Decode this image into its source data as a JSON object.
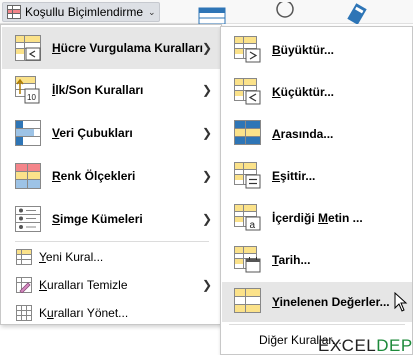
{
  "ribbon": {
    "conditional_formatting_label": "Koşullu Biçimlendirme"
  },
  "menu": {
    "items": [
      {
        "pre": "",
        "u": "H",
        "post": "ücre Vurgulama Kuralları",
        "icon": "highlight-cells-icon"
      },
      {
        "pre": "",
        "u": "İ",
        "post": "lk/Son Kuralları",
        "icon": "top-bottom-icon"
      },
      {
        "pre": "",
        "u": "V",
        "post": "eri Çubukları",
        "icon": "data-bars-icon"
      },
      {
        "pre": "",
        "u": "R",
        "post": "enk Ölçekleri",
        "icon": "color-scales-icon"
      },
      {
        "pre": "",
        "u": "S",
        "post": "imge Kümeleri",
        "icon": "icon-sets-icon"
      }
    ],
    "small_items": [
      {
        "pre": "",
        "u": "Y",
        "post": "eni Kural...",
        "icon": "new-rule-icon"
      },
      {
        "pre": "",
        "u": "K",
        "post": "uralları Temizle",
        "icon": "clear-rules-icon"
      },
      {
        "pre": "K",
        "u": "u",
        "post": "ralları Yönet...",
        "icon": "manage-rules-icon"
      }
    ]
  },
  "submenu": {
    "items": [
      {
        "pre": "",
        "u": "B",
        "post": "üyüktür...",
        "icon": "greater-than-icon"
      },
      {
        "pre": "",
        "u": "K",
        "post": "üçüktür...",
        "icon": "less-than-icon"
      },
      {
        "pre": "",
        "u": "A",
        "post": "rasında...",
        "icon": "between-icon"
      },
      {
        "pre": "",
        "u": "E",
        "post": "şittir...",
        "icon": "equal-to-icon"
      },
      {
        "pre": "İçerdiği ",
        "u": "M",
        "post": "etin ...",
        "icon": "text-contains-icon"
      },
      {
        "pre": "",
        "u": "T",
        "post": "arih...",
        "icon": "date-occurring-icon"
      },
      {
        "pre": "",
        "u": "Y",
        "post": "inelenen Değerler...",
        "icon": "duplicate-values-icon"
      }
    ],
    "more_rules": {
      "pre": "Di",
      "u": "ğ",
      "post": "er Kurallar..."
    }
  },
  "watermark": {
    "part1": "EXCEL",
    "part2": "DEPO"
  },
  "colors": {
    "highlight": "#e6e6e6",
    "icon_yellow": "#fbe28a",
    "icon_blue": "#2e75b6",
    "icon_red": "#f4858a",
    "brand_green": "#1d8a3a"
  }
}
